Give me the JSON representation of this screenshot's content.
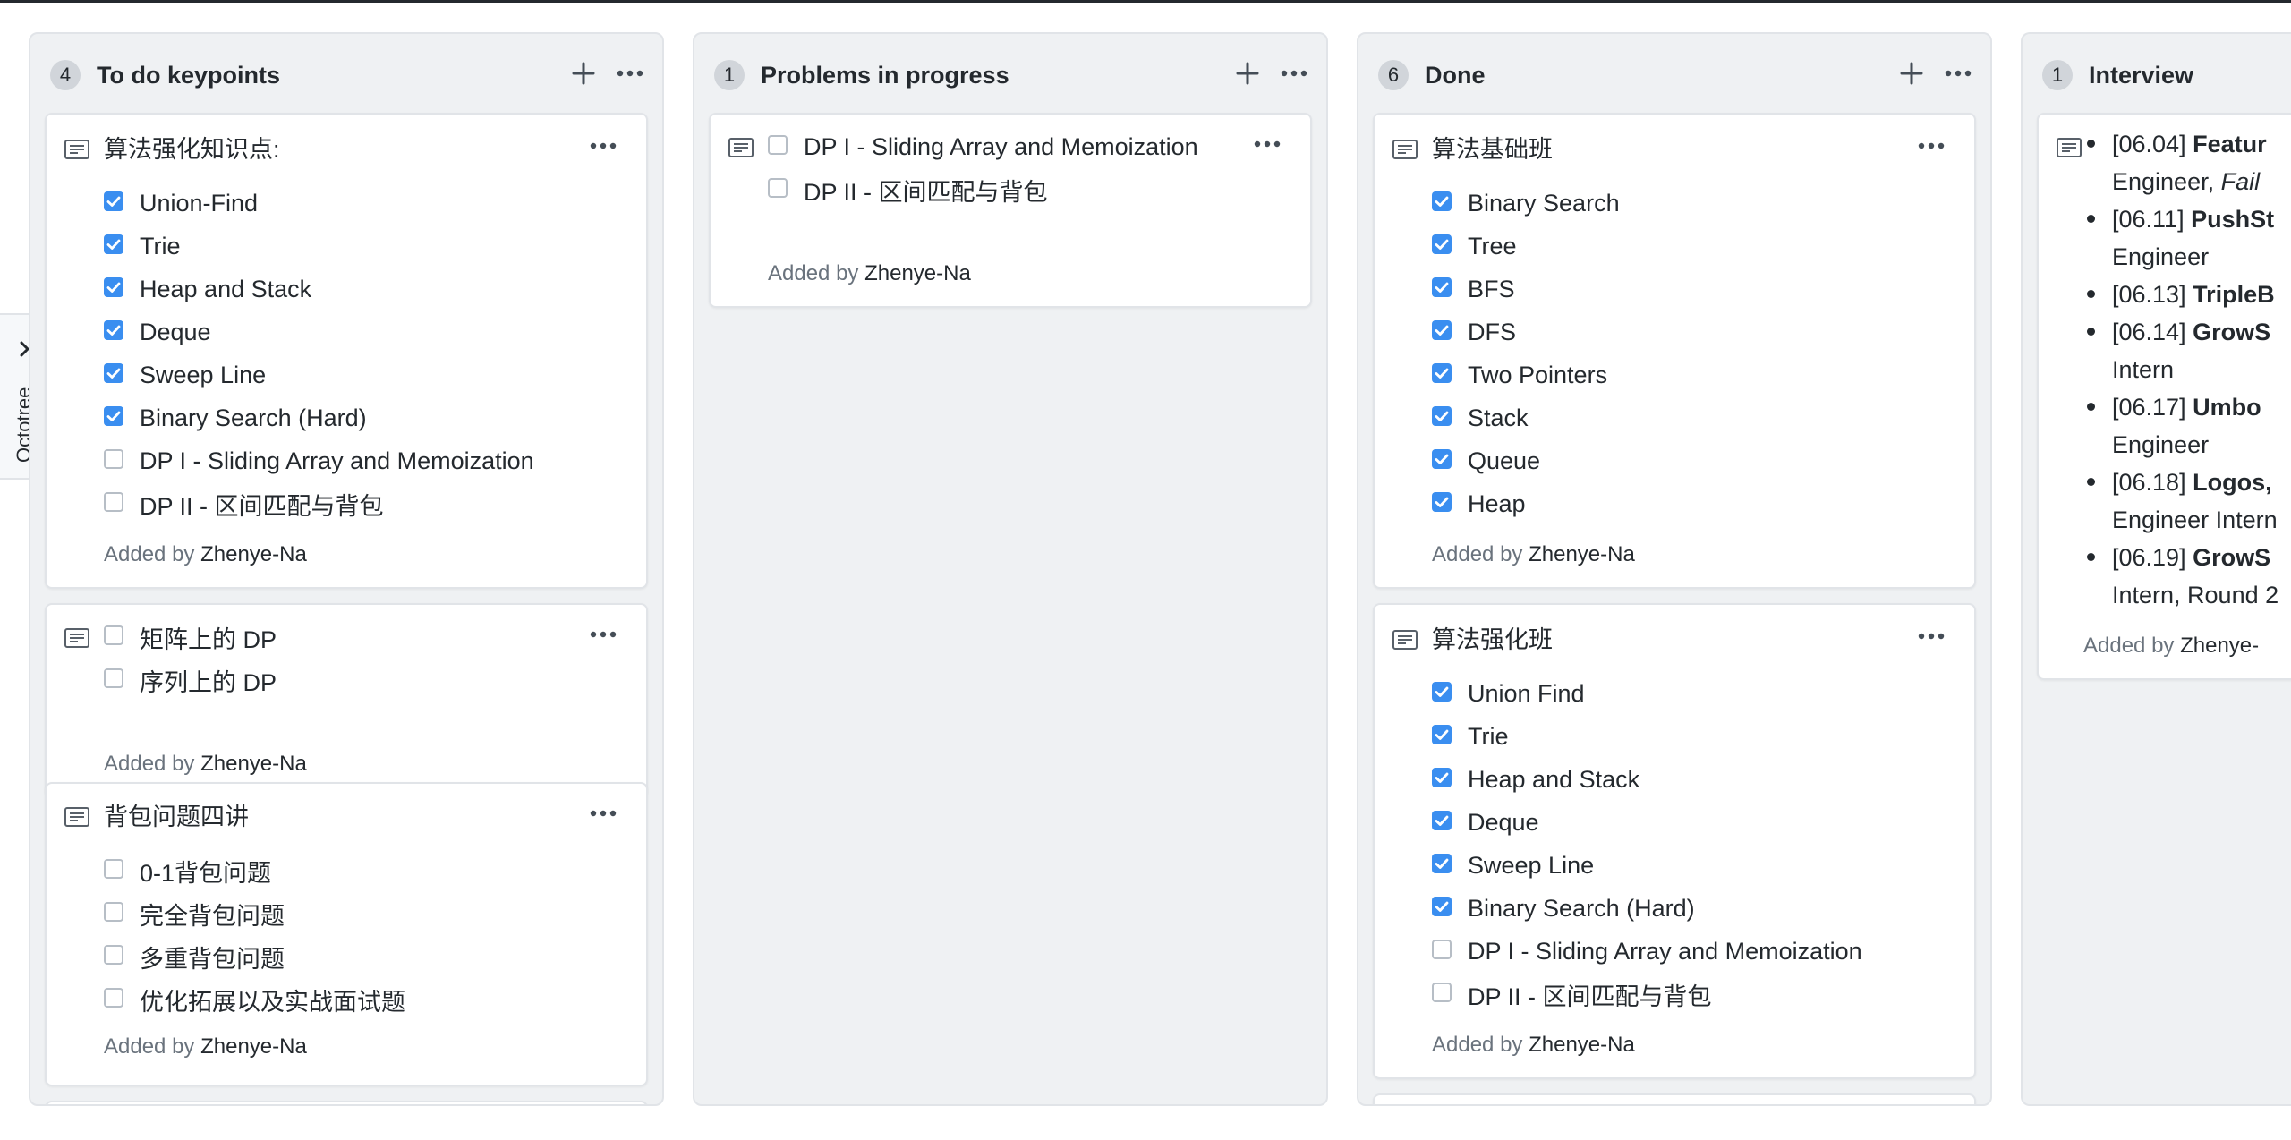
{
  "octotree": {
    "label": "Octotree"
  },
  "colors": {
    "checkbox_checked": "#3a8ef0",
    "column_bg": "#eff1f3",
    "muted_text": "#6a737d"
  },
  "columns": [
    {
      "count": "4",
      "title": "To do keypoints",
      "cards": [
        {
          "title": "算法强化知识点:",
          "tasks": [
            {
              "label": "Union-Find",
              "checked": true
            },
            {
              "label": "Trie",
              "checked": true
            },
            {
              "label": "Heap and Stack",
              "checked": true
            },
            {
              "label": "Deque",
              "checked": true
            },
            {
              "label": "Sweep Line",
              "checked": true
            },
            {
              "label": "Binary Search (Hard)",
              "checked": true
            },
            {
              "label": "DP I - Sliding Array and Memoization",
              "checked": false
            },
            {
              "label": "DP II - 区间匹配与背包",
              "checked": false
            }
          ],
          "added_prefix": "Added by",
          "added_by": "Zhenye-Na"
        },
        {
          "title": "",
          "tasks": [
            {
              "label": "矩阵上的 DP",
              "checked": false
            },
            {
              "label": "序列上的 DP",
              "checked": false
            }
          ],
          "added_prefix": "Added by",
          "added_by": "Zhenye-Na"
        },
        {
          "title": "背包问题四讲",
          "tasks": [
            {
              "label": "0-1背包问题",
              "checked": false
            },
            {
              "label": "完全背包问题",
              "checked": false
            },
            {
              "label": "多重背包问题",
              "checked": false
            },
            {
              "label": "优化拓展以及实战面试题",
              "checked": false
            }
          ],
          "added_prefix": "Added by",
          "added_by": "Zhenye-Na"
        }
      ]
    },
    {
      "count": "1",
      "title": "Problems in progress",
      "cards": [
        {
          "title": "",
          "tasks": [
            {
              "label": "DP I - Sliding Array and Memoization",
              "checked": false
            },
            {
              "label": "DP II - 区间匹配与背包",
              "checked": false
            }
          ],
          "added_prefix": "Added by",
          "added_by": "Zhenye-Na"
        }
      ]
    },
    {
      "count": "6",
      "title": "Done",
      "cards": [
        {
          "title": "算法基础班",
          "tasks": [
            {
              "label": "Binary Search",
              "checked": true
            },
            {
              "label": "Tree",
              "checked": true
            },
            {
              "label": "BFS",
              "checked": true
            },
            {
              "label": "DFS",
              "checked": true
            },
            {
              "label": "Two Pointers",
              "checked": true
            },
            {
              "label": "Stack",
              "checked": true
            },
            {
              "label": "Queue",
              "checked": true
            },
            {
              "label": "Heap",
              "checked": true
            }
          ],
          "added_prefix": "Added by",
          "added_by": "Zhenye-Na"
        },
        {
          "title": "算法强化班",
          "tasks": [
            {
              "label": "Union Find",
              "checked": true
            },
            {
              "label": "Trie",
              "checked": true
            },
            {
              "label": "Heap and Stack",
              "checked": true
            },
            {
              "label": "Deque",
              "checked": true
            },
            {
              "label": "Sweep Line",
              "checked": true
            },
            {
              "label": "Binary Search (Hard)",
              "checked": true
            },
            {
              "label": "DP I - Sliding Array and Memoization",
              "checked": false
            },
            {
              "label": "DP II - 区间匹配与背包",
              "checked": false
            }
          ],
          "added_prefix": "Added by",
          "added_by": "Zhenye-Na"
        }
      ]
    },
    {
      "count": "1",
      "title": "Interview",
      "cards": [
        {
          "bullets": [
            {
              "date": "[06.04]",
              "bold": "Featur",
              "rest": "Engineer, ",
              "italic": "Fail"
            },
            {
              "date": "[06.11]",
              "bold": "PushSt",
              "rest": "Engineer",
              "italic": ""
            },
            {
              "date": "[06.13]",
              "bold": "TripleB",
              "rest": "",
              "italic": ""
            },
            {
              "date": "[06.14]",
              "bold": "GrowS",
              "rest": "Intern",
              "italic": ""
            },
            {
              "date": "[06.17]",
              "bold": "Umbo",
              "rest": "Engineer",
              "italic": ""
            },
            {
              "date": "[06.18]",
              "bold": "Logos,",
              "rest": "Engineer Intern",
              "italic": ""
            },
            {
              "date": "[06.19]",
              "bold": "GrowS",
              "rest": "Intern, Round 2",
              "italic": ""
            }
          ],
          "added_prefix": "Added by",
          "added_by": "Zhenye-"
        }
      ]
    }
  ]
}
